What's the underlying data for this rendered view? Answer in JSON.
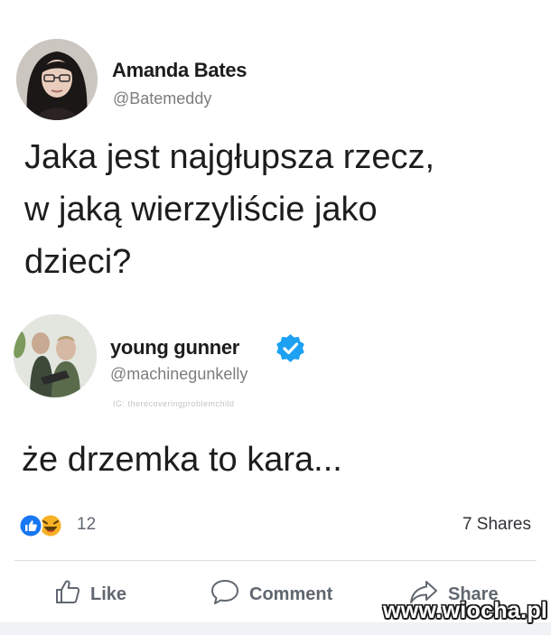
{
  "post1": {
    "author_name": "Amanda Bates",
    "author_handle": "@Batemeddy",
    "text": "Jaka jest najgłupsza rzecz,\nw jaką wierzyliście jako\ndzieci?"
  },
  "post2": {
    "author_name": "young gunner",
    "author_handle": "@machinegunkelly",
    "ig_credit": "IG: therecoveringproblemchild",
    "text": "że drzemka to kara..."
  },
  "stats": {
    "reaction_count": "12",
    "shares": "7 Shares"
  },
  "actions": {
    "like": "Like",
    "comment": "Comment",
    "share": "Share"
  },
  "watermark": "www.wiocha.pl",
  "colors": {
    "accent_blue": "#1877f2",
    "verified_blue": "#1da1f2",
    "haha_yellow": "#f7b125"
  }
}
